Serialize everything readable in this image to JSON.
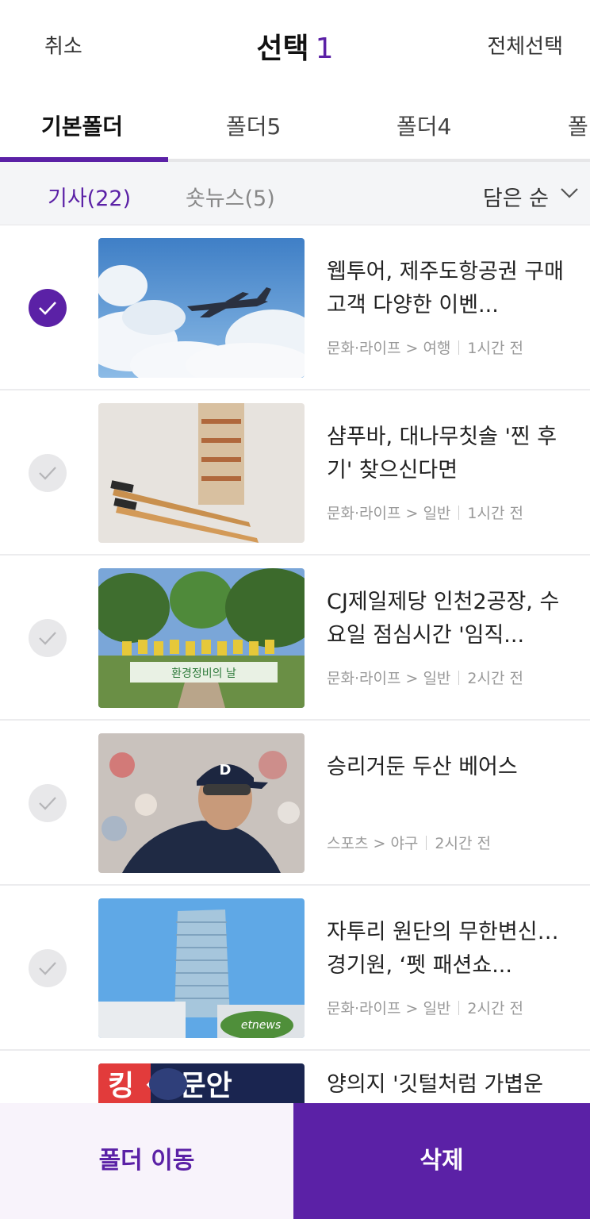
{
  "header": {
    "cancel": "취소",
    "title": "선택",
    "count": "1",
    "select_all": "전체선택"
  },
  "folder_tabs": [
    "기본폴더",
    "폴더5",
    "폴더4",
    "폴"
  ],
  "sub_tabs": [
    "기사(22)",
    "숏뉴스(5)"
  ],
  "sort_label": "담은 순",
  "articles": [
    {
      "selected": true,
      "headline": "웹투어, 제주도항공권 구매고객 다양한 이벤...",
      "category": "문화·라이프 > 여행",
      "time": "1시간 전"
    },
    {
      "selected": false,
      "headline": "샴푸바, 대나무칫솔 '찐 후기' 찾으신다면",
      "category": "문화·라이프 > 일반",
      "time": "1시간 전"
    },
    {
      "selected": false,
      "headline": "CJ제일제당 인천2공장, 수요일 점심시간 '임직...",
      "category": "문화·라이프 > 일반",
      "time": "2시간 전"
    },
    {
      "selected": false,
      "headline": "승리거둔 두산 베어스",
      "category": "스포츠 > 야구",
      "time": "2시간 전"
    },
    {
      "selected": false,
      "headline": "자투리 원단의 무한변신…경기원, ‘펫 패션쇼...",
      "category": "문화·라이프 > 일반",
      "time": "2시간 전"
    },
    {
      "selected": false,
      "headline": "양의지 '깃털처럼 가볍운",
      "category": "",
      "time": ""
    }
  ],
  "thumbnail_texts": {
    "banner": "환경정비의 날",
    "watermark": "etnews",
    "sign": "킹 ❖ 문안"
  },
  "actions": {
    "move": "폴더 이동",
    "delete": "삭제"
  },
  "colors": {
    "accent": "#5b21a6",
    "move_bg": "#f8f3fb"
  }
}
